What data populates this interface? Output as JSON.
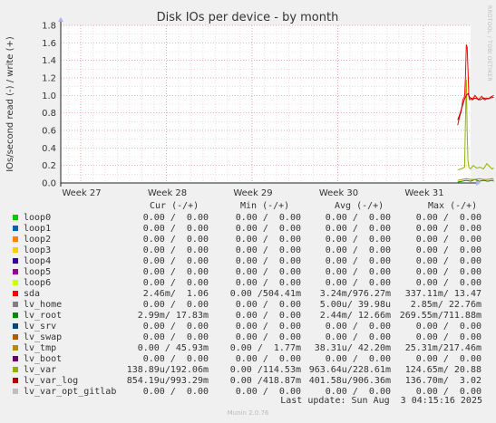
{
  "chart_data": {
    "type": "line",
    "title": "Disk IOs per device - by month",
    "ylabel": "IOs/second read (-) / write (+)",
    "ylim": [
      0,
      1.8
    ],
    "yticks": [
      "0.0",
      "0.2",
      "0.4",
      "0.6",
      "0.8",
      "1.0",
      "1.2",
      "1.4",
      "1.6",
      "1.8"
    ],
    "xticks": [
      "Week 27",
      "Week 28",
      "Week 29",
      "Week 30",
      "Week 31"
    ],
    "grid": true,
    "series": [
      {
        "name": "loop0",
        "color": "#00cc00",
        "cur": "0.00 /  0.00",
        "min": "0.00 /  0.00",
        "avg": "0.00 /  0.00",
        "max": "0.00 /  0.00",
        "x": [],
        "y": []
      },
      {
        "name": "loop1",
        "color": "#0066b3",
        "cur": "0.00 /  0.00",
        "min": "0.00 /  0.00",
        "avg": "0.00 /  0.00",
        "max": "0.00 /  0.00",
        "x": [],
        "y": []
      },
      {
        "name": "loop2",
        "color": "#ff8000",
        "cur": "0.00 /  0.00",
        "min": "0.00 /  0.00",
        "avg": "0.00 /  0.00",
        "max": "0.00 /  0.00",
        "x": [],
        "y": []
      },
      {
        "name": "loop3",
        "color": "#ffcc00",
        "cur": "0.00 /  0.00",
        "min": "0.00 /  0.00",
        "avg": "0.00 /  0.00",
        "max": "0.00 /  0.00",
        "x": [],
        "y": []
      },
      {
        "name": "loop4",
        "color": "#330099",
        "cur": "0.00 /  0.00",
        "min": "0.00 /  0.00",
        "avg": "0.00 /  0.00",
        "max": "0.00 /  0.00",
        "x": [],
        "y": []
      },
      {
        "name": "loop5",
        "color": "#990099",
        "cur": "0.00 /  0.00",
        "min": "0.00 /  0.00",
        "avg": "0.00 /  0.00",
        "max": "0.00 /  0.00",
        "x": [],
        "y": []
      },
      {
        "name": "loop6",
        "color": "#ccff00",
        "cur": "0.00 /  0.00",
        "min": "0.00 /  0.00",
        "avg": "0.00 /  0.00",
        "max": "0.00 /  0.00",
        "x": [],
        "y": []
      },
      {
        "name": "sda",
        "color": "#ff0000",
        "cur": "2.46m/  1.06",
        "min": "0.00 /504.41m",
        "avg": "3.24m/976.27m",
        "max": "337.11m/ 13.47",
        "x": [
          4.4,
          4.42,
          4.44,
          4.46,
          4.48,
          4.49,
          4.5,
          4.51,
          4.52,
          4.53,
          4.54,
          4.56,
          4.58,
          4.6,
          4.62,
          4.64,
          4.66,
          4.68,
          4.7,
          4.72,
          4.74,
          4.76,
          4.78,
          4.8,
          4.82
        ],
        "y": [
          0.66,
          0.75,
          0.82,
          0.95,
          0.99,
          1.2,
          1.58,
          1.55,
          1.3,
          0.98,
          0.95,
          0.97,
          0.96,
          1.0,
          0.98,
          0.95,
          0.97,
          0.99,
          0.96,
          0.95,
          0.97,
          0.96,
          0.98,
          0.99,
          1.0
        ]
      },
      {
        "name": "lv_home",
        "color": "#808080",
        "cur": "0.00 /  0.00",
        "min": "0.00 /  0.00",
        "avg": "5.00u/ 39.98u",
        "max": "2.85m/ 22.76m",
        "x": [],
        "y": []
      },
      {
        "name": "lv_root",
        "color": "#008f00",
        "cur": "2.99m/ 17.83m",
        "min": "0.00 /  0.00",
        "avg": "2.44m/ 12.66m",
        "max": "269.55m/711.88m",
        "x": [
          4.4,
          4.45,
          4.5,
          4.55,
          4.6,
          4.65,
          4.7,
          4.75,
          4.8,
          4.82
        ],
        "y": [
          0.01,
          0.02,
          0.03,
          0.02,
          0.04,
          0.02,
          0.03,
          0.02,
          0.03,
          0.02
        ]
      },
      {
        "name": "lv_srv",
        "color": "#00487d",
        "cur": "0.00 /  0.00",
        "min": "0.00 /  0.00",
        "avg": "0.00 /  0.00",
        "max": "0.00 /  0.00",
        "x": [],
        "y": []
      },
      {
        "name": "lv_swap",
        "color": "#b35a00",
        "cur": "0.00 /  0.00",
        "min": "0.00 /  0.00",
        "avg": "0.00 /  0.00",
        "max": "0.00 /  0.00",
        "x": [],
        "y": []
      },
      {
        "name": "lv_tmp",
        "color": "#b38f00",
        "cur": "0.00 / 45.93m",
        "min": "0.00 /  1.77m",
        "avg": "38.31u/ 42.20m",
        "max": "25.31m/217.46m",
        "x": [
          4.4,
          4.45,
          4.5,
          4.55,
          4.6,
          4.65,
          4.7,
          4.75,
          4.8,
          4.82
        ],
        "y": [
          0.03,
          0.04,
          0.05,
          0.04,
          0.04,
          0.05,
          0.04,
          0.04,
          0.05,
          0.04
        ]
      },
      {
        "name": "lv_boot",
        "color": "#6b006b",
        "cur": "0.00 /  0.00",
        "min": "0.00 /  0.00",
        "avg": "0.00 /  0.00",
        "max": "0.00 /  0.00",
        "x": [],
        "y": []
      },
      {
        "name": "lv_var",
        "color": "#8fb300",
        "cur": "138.89u/192.06m",
        "min": "0.00 /114.53m",
        "avg": "963.64u/228.61m",
        "max": "124.65m/ 20.88",
        "x": [
          4.4,
          4.44,
          4.48,
          4.49,
          4.5,
          4.51,
          4.52,
          4.53,
          4.55,
          4.58,
          4.62,
          4.66,
          4.7,
          4.74,
          4.78,
          4.8,
          4.82
        ],
        "y": [
          0.15,
          0.16,
          0.18,
          0.7,
          1.18,
          0.6,
          0.25,
          0.18,
          0.16,
          0.2,
          0.17,
          0.18,
          0.16,
          0.22,
          0.18,
          0.16,
          0.17
        ]
      },
      {
        "name": "lv_var_log",
        "color": "#b30000",
        "cur": "854.19u/993.29m",
        "min": "0.00 /418.87m",
        "avg": "401.58u/906.36m",
        "max": "136.70m/  3.02",
        "x": [
          4.4,
          4.43,
          4.46,
          4.48,
          4.5,
          4.52,
          4.54,
          4.57,
          4.6,
          4.63,
          4.66,
          4.7,
          4.74,
          4.78,
          4.82
        ],
        "y": [
          0.72,
          0.8,
          0.9,
          0.96,
          1.0,
          1.02,
          0.98,
          0.95,
          0.97,
          0.96,
          0.95,
          0.97,
          0.96,
          0.97,
          0.98
        ]
      },
      {
        "name": "lv_var_opt_gitlab",
        "color": "#bebebe",
        "cur": "0.00 /  0.00",
        "min": "0.00 /  0.00",
        "avg": "0.00 /  0.00",
        "max": "0.00 /  0.00",
        "x": [],
        "y": []
      }
    ]
  },
  "legend_headers": {
    "cur": "Cur (-/+)",
    "min": "Min (-/+)",
    "avg": "Avg (-/+)",
    "max": "Max (-/+)"
  },
  "last_update": "Last update: Sun Aug  3 04:15:16 2025",
  "munin_version": "Munin 2.0.76",
  "side_label": "RRDTOOL / TOBI OETIKER"
}
